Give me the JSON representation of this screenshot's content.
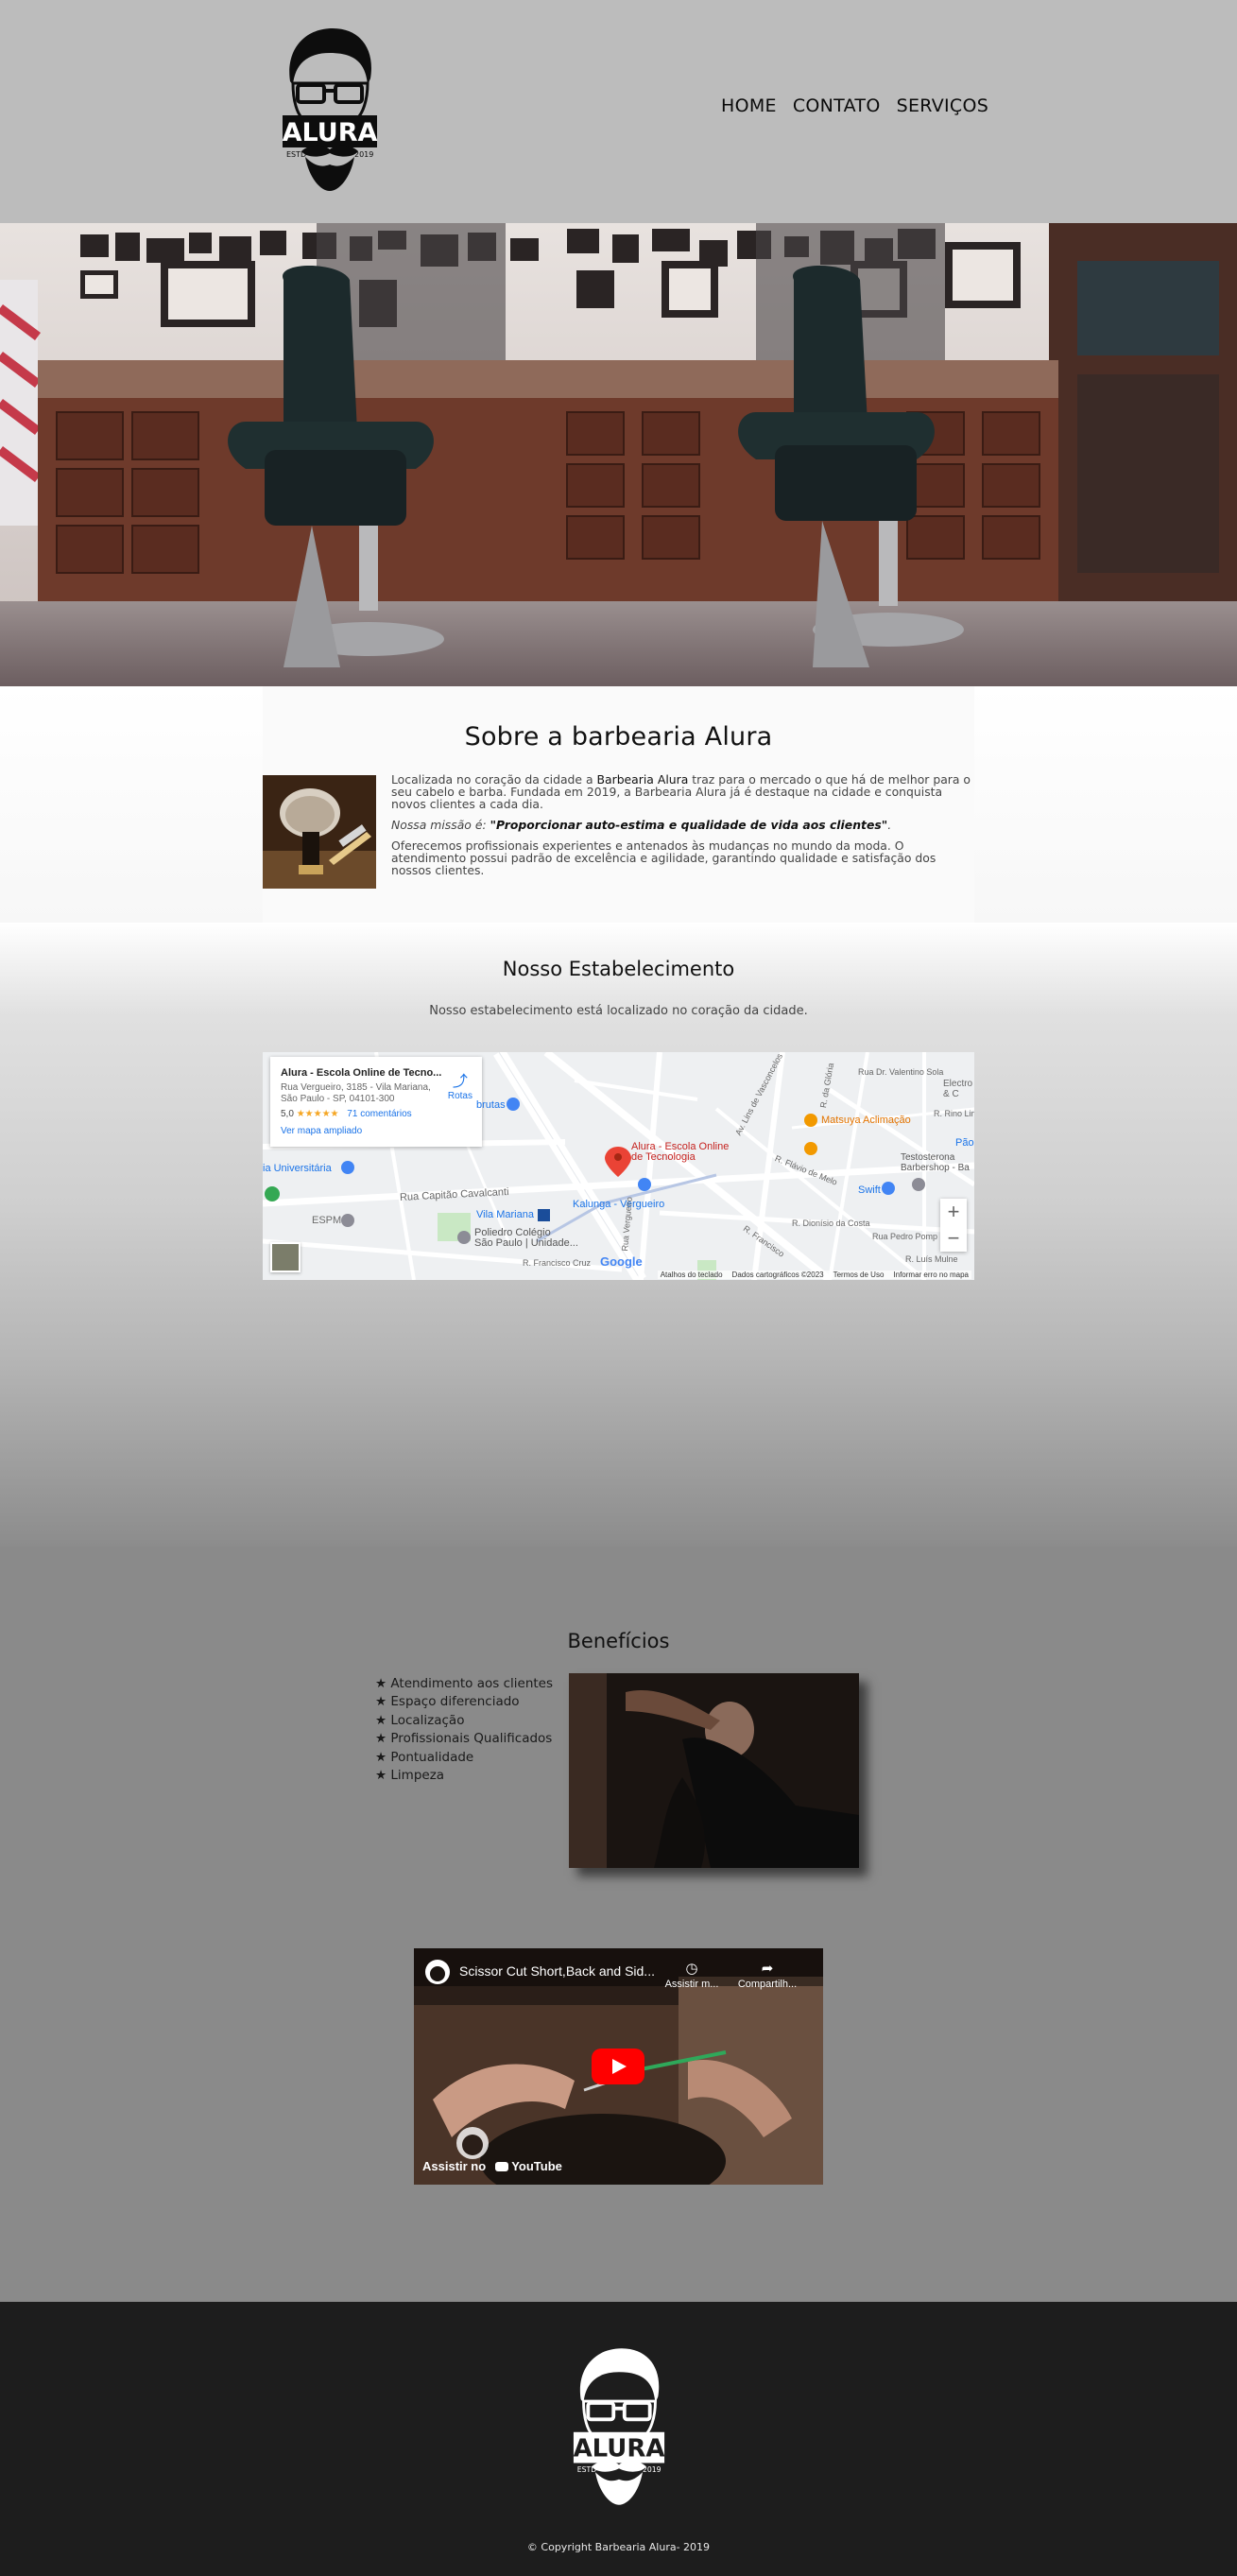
{
  "header": {
    "logo_text": "ALURA",
    "logo_estd": "ESTD",
    "logo_year": "2019",
    "nav": [
      {
        "label": "HOME"
      },
      {
        "label": "CONTATO"
      },
      {
        "label": "SERVIÇOS"
      }
    ]
  },
  "about": {
    "title": "Sobre a barbearia Alura",
    "p1_a": "Localizada no coração da cidade a ",
    "p1_brand": "Barbearia Alura",
    "p1_b": " traz para o mercado o que há de melhor para o seu cabelo e barba. Fundada em 2019, a Barbearia Alura já é destaque na cidade e conquista novos clientes a cada dia.",
    "mission_label": "Nossa missão é: ",
    "mission_text": "\"Proporcionar auto-estima e qualidade de vida aos clientes\"",
    "mission_end": ".",
    "p3": "Oferecemos profissionais experientes e antenados às mudanças no mundo da moda. O atendimento possui padrão de excelência e agilidade, garantindo qualidade e satisfação dos nossos clientes."
  },
  "establishment": {
    "title": "Nosso Estabelecimento",
    "subtitle": "Nosso estabelecimento está localizado no coração da cidade.",
    "map": {
      "card_title": "Alura - Escola Online de Tecno...",
      "card_address_1": "Rua Vergueiro, 3185 - Vila Mariana,",
      "card_address_2": "São Paulo - SP, 04101-300",
      "rating": "5,0",
      "stars": "★★★★★",
      "reviews": "71 comentários",
      "larger_map": "Ver mapa ampliado",
      "directions": "Rotas",
      "pin_label_1": "Alura - Escola Online",
      "pin_label_2": "de Tecnologia",
      "labels": {
        "brutas": "brutas",
        "universitaria": "ia Universitária",
        "espm": "ESPM",
        "capitao": "Rua Capitão Cavalcanti",
        "vila_mariana": "Vila Mariana",
        "kalunga": "Kalunga - Vergueiro",
        "poliedro1": "Poliedro Colégio",
        "poliedro2": "São Paulo | Unidade...",
        "francisco": "R. Francisco Cruz",
        "vergueiro": "Rua Vergueiro",
        "matsuya": "Matsuya Aclimação",
        "testosterona1": "Testosterona",
        "testosterona2": "Barbershop - Ba",
        "swift": "Swift",
        "valentino": "Rua Dr. Valentino Sola",
        "rino": "R. Rino Lini",
        "electro1": "Electro",
        "electro2": "& C",
        "pao": "Pão",
        "flavio": "R. Flávio de Melo",
        "dionisio": "R. Dionísio da Costa",
        "pedro": "Rua Pedro Pomp",
        "luis": "R. Luís Mulne",
        "linha": "Av. Lins de Vasconcelos",
        "gloria": "R. da Glória",
        "francisco2": "R. Francisco"
      },
      "footer": [
        "Atalhos do teclado",
        "Dados cartográficos ©2023",
        "Termos de Uso",
        "Informar erro no mapa"
      ],
      "google": "Google",
      "zoom_in": "+",
      "zoom_out": "−"
    }
  },
  "benefits": {
    "title": "Benefícios",
    "items": [
      "Atendimento aos clientes",
      "Espaço diferenciado",
      "Localização",
      "Profissionais Qualificados",
      "Pontualidade",
      "Limpeza"
    ]
  },
  "video": {
    "title": "Scissor Cut Short,Back and Sid...",
    "watch_later": "Assistir m...",
    "share": "Compartilh...",
    "watch_on": "Assistir no",
    "youtube": "YouTube"
  },
  "footer": {
    "copyright": "© Copyright Barbearia Alura- 2019"
  },
  "colors": {
    "header_bg": "#bcbcbc",
    "body_bg": "#8a8a8a",
    "footer_bg": "#1d1d1d",
    "map_link": "#1a73e8",
    "map_pin": "#ea4335",
    "youtube_red": "#ff0000"
  }
}
